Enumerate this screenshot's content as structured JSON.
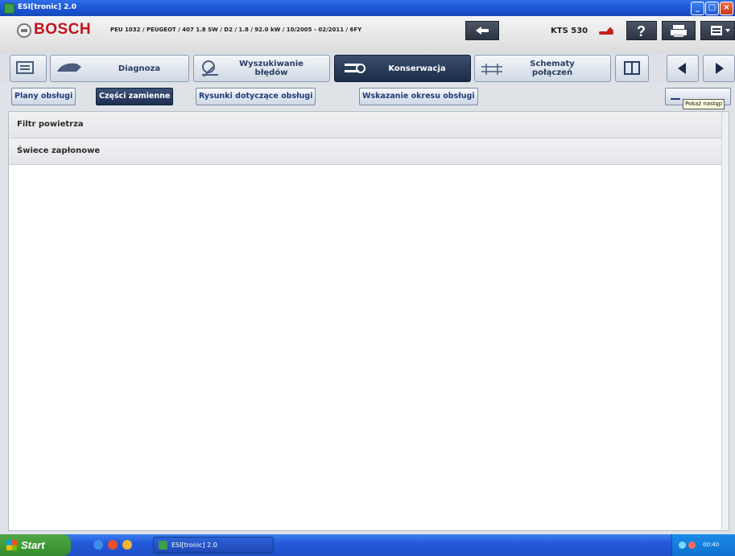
{
  "window": {
    "title": "ESI[tronic] 2.0",
    "buttons": {
      "minimize": "_",
      "maximize": "□",
      "close": "×"
    }
  },
  "header": {
    "brand": "BOSCH",
    "vehicle": "PEU 1032 / PEUGEOT / 407 1.8 SW / D2 / 1.8 / 92.0 kW / 10/2005 - 02/2011 / 6FY",
    "device": "KTS 530"
  },
  "nav": {
    "diagnosis": "Diagnoza",
    "fault_search_line1": "Wyszukiwanie",
    "fault_search_line2": "błędów",
    "maintenance": "Konserwacja",
    "wiring_line1": "Schematy",
    "wiring_line2": "połączeń"
  },
  "subtabs": [
    {
      "label": "Plany obsługi"
    },
    {
      "label": "Części zamienne"
    },
    {
      "label": "Rysunki dotyczące obsługi"
    },
    {
      "label": "Wskazanie okresu obsługi"
    }
  ],
  "tooltip": "Pokaż następ",
  "content": {
    "items": [
      {
        "label": "Filtr powietrza"
      },
      {
        "label": "Świece zapłonowe"
      }
    ]
  },
  "taskbar": {
    "start": "Start",
    "task": "ESI[tronic] 2.0",
    "clock": "00:40"
  },
  "colors": {
    "brand_red": "#c1141c",
    "active_tab": "#1c2c48",
    "titlebar_blue": "#1b55d6"
  }
}
